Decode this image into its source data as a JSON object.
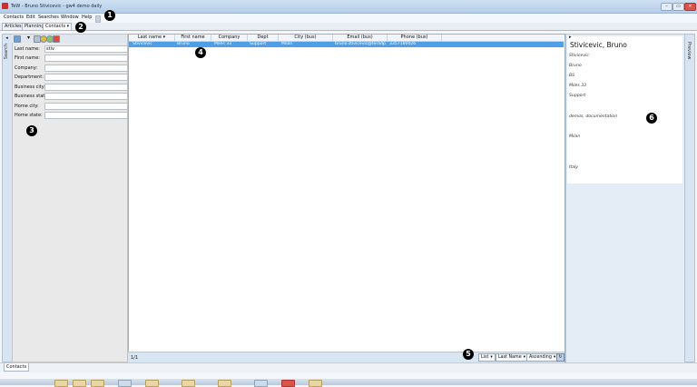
{
  "window": {
    "title": "TeW - Bruno Stivicevic - gw4 demo daily",
    "buttons": [
      "–",
      "▭",
      "✕"
    ]
  },
  "menu": [
    "Contacts",
    "Edit",
    "Searches",
    "Window",
    "Help"
  ],
  "tabs": [
    "Articles",
    "Planning",
    "Contacts"
  ],
  "left_strip_label": "Search",
  "search_fields": [
    {
      "label": "Last name:",
      "value": "stiv"
    },
    {
      "label": "First name:",
      "value": ""
    },
    {
      "label": "Company:",
      "value": ""
    },
    {
      "label": "Department:",
      "value": ""
    },
    {
      "label": "Business city:",
      "value": ""
    },
    {
      "label": "Business state:",
      "value": ""
    },
    {
      "label": "Home city:",
      "value": ""
    },
    {
      "label": "Home state:",
      "value": ""
    }
  ],
  "list": {
    "columns": [
      "Last name",
      "First name",
      "Company",
      "Dept",
      "City (bus)",
      "Email (bus)",
      "Phone (bus)"
    ],
    "rows": [
      [
        "Stivicevic",
        "Bruno",
        "Miles 33",
        "Support",
        "Milan",
        "bruno.stivicevic@teradp.c",
        "3357180026"
      ]
    ],
    "count": "1/1",
    "view_mode": "List",
    "sort_field": "Last Name",
    "sort_order": "Ascending"
  },
  "preview": {
    "title": "Stivicevic, Bruno",
    "lines": [
      "Stivicevic",
      "Bruno",
      "BS",
      "Miles 33",
      "Support",
      "demos, documentation",
      "Milan",
      "Italy"
    ],
    "side_label": "Preview"
  },
  "bottom_tab": "Contacts",
  "callouts": [
    "1",
    "2",
    "3",
    "4",
    "5",
    "6"
  ],
  "colors": {
    "selection": "#4f9fe8",
    "accent": "#c8322b"
  }
}
